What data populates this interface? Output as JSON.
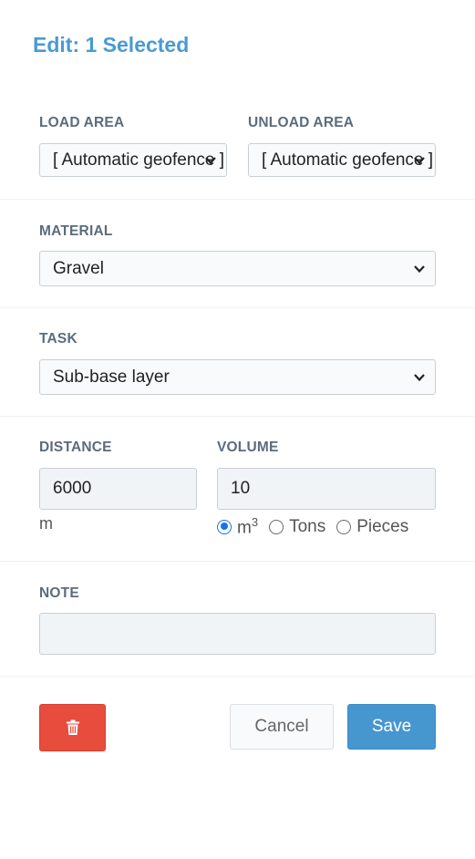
{
  "header": {
    "title": "Edit: 1 Selected"
  },
  "load_area": {
    "label": "LOAD AREA",
    "value": "[ Automatic geofence ]"
  },
  "unload_area": {
    "label": "UNLOAD AREA",
    "value": "[ Automatic geofence ]"
  },
  "material": {
    "label": "MATERIAL",
    "value": "Gravel"
  },
  "task": {
    "label": "TASK",
    "value": "Sub-base layer"
  },
  "distance": {
    "label": "DISTANCE",
    "value": "6000",
    "unit": "m"
  },
  "volume": {
    "label": "VOLUME",
    "value": "10",
    "units": [
      {
        "label": "m",
        "sup": "3",
        "selected": true
      },
      {
        "label": "Tons",
        "selected": false
      },
      {
        "label": "Pieces",
        "selected": false
      }
    ]
  },
  "note": {
    "label": "NOTE",
    "value": ""
  },
  "actions": {
    "delete_icon": "trash-icon",
    "cancel_label": "Cancel",
    "save_label": "Save"
  },
  "colors": {
    "title": "#4a9bd0",
    "delete": "#e74c3c",
    "save": "#4696cf",
    "radio_selected": "#1a73e8"
  }
}
